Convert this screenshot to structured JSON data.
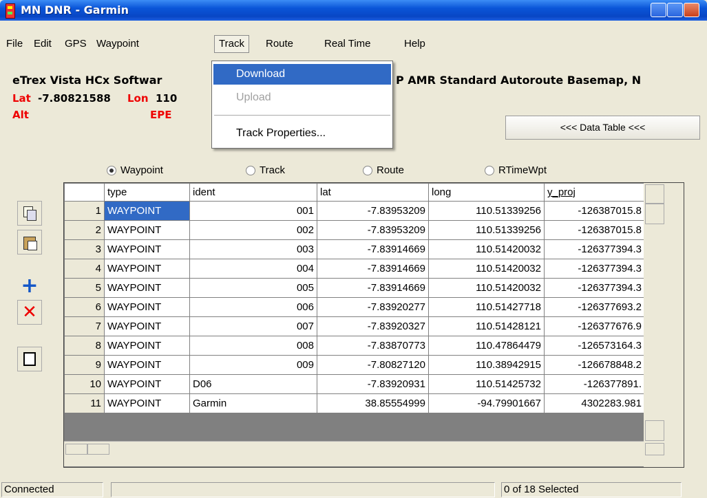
{
  "window": {
    "title": "MN DNR - Garmin"
  },
  "menu": [
    "File",
    "Edit",
    "GPS",
    "Waypoint",
    "Track",
    "Route",
    "Real Time",
    "Help"
  ],
  "track_menu": {
    "items": [
      "Download",
      "Upload",
      "Track Properties..."
    ],
    "active": "Download",
    "disabled": "Upload"
  },
  "info": {
    "device_left": "eTrex Vista HCx Softwar",
    "device_right": "P AMR Standard Autoroute Basemap, N",
    "lat_label": "Lat",
    "lat_value": "-7.80821588",
    "lon_label": "Lon",
    "lon_value": "110",
    "alt_label": "Alt",
    "epe_label": "EPE"
  },
  "data_table_button": "<<< Data Table <<<",
  "radios": [
    {
      "label": "Waypoint",
      "checked": true
    },
    {
      "label": "Track",
      "checked": false
    },
    {
      "label": "Route",
      "checked": false
    },
    {
      "label": "RTimeWpt",
      "checked": false
    }
  ],
  "tools": [
    "copy-icon",
    "paste-icon",
    "add-icon",
    "delete-icon",
    "select-box-icon"
  ],
  "table": {
    "columns": [
      "type",
      "ident",
      "lat",
      "long",
      "y_proj"
    ],
    "rows": [
      [
        "1",
        "WAYPOINT",
        "001",
        "-7.83953209",
        "110.51339256",
        "-126387015.8"
      ],
      [
        "2",
        "WAYPOINT",
        "002",
        "-7.83953209",
        "110.51339256",
        "-126387015.8"
      ],
      [
        "3",
        "WAYPOINT",
        "003",
        "-7.83914669",
        "110.51420032",
        "-126377394.3"
      ],
      [
        "4",
        "WAYPOINT",
        "004",
        "-7.83914669",
        "110.51420032",
        "-126377394.3"
      ],
      [
        "5",
        "WAYPOINT",
        "005",
        "-7.83914669",
        "110.51420032",
        "-126377394.3"
      ],
      [
        "6",
        "WAYPOINT",
        "006",
        "-7.83920277",
        "110.51427718",
        "-126377693.2"
      ],
      [
        "7",
        "WAYPOINT",
        "007",
        "-7.83920327",
        "110.51428121",
        "-126377676.9"
      ],
      [
        "8",
        "WAYPOINT",
        "008",
        "-7.83870773",
        "110.47864479",
        "-126573164.3"
      ],
      [
        "9",
        "WAYPOINT",
        "009",
        "-7.80827120",
        "110.38942915",
        "-126678848.2"
      ],
      [
        "10",
        "WAYPOINT",
        "D06",
        "-7.83920931",
        "110.51425732",
        "-126377891."
      ],
      [
        "11",
        "WAYPOINT",
        "Garmin",
        "38.85554999",
        "-94.79901667",
        "4302283.981"
      ]
    ]
  },
  "status": {
    "left": "Connected",
    "middle": "",
    "right": "0 of 18 Selected"
  },
  "colors": {
    "selection": "#316ac5",
    "label_red": "#e00000",
    "title_blue": "#0a55d8"
  }
}
